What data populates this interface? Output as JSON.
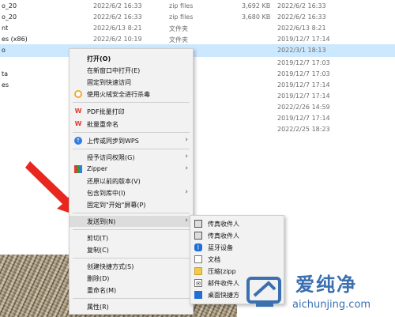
{
  "file_list": {
    "rows": [
      {
        "name": "o_20",
        "date": "2022/6/2 16:33",
        "type": "zip files",
        "size": "3,692 KB",
        "modified": "2022/6/2 16:33"
      },
      {
        "name": "o_20",
        "date": "2022/6/2 16:33",
        "type": "zip files",
        "size": "3,680 KB",
        "modified": "2022/6/2 16:33"
      },
      {
        "name": "nt",
        "date": "2022/6/13 8:21",
        "type": "文件夹",
        "size": "",
        "modified": "2022/6/13 8:21"
      },
      {
        "name": "es (x86)",
        "date": "2022/6/2 10:19",
        "type": "文件夹",
        "size": "",
        "modified": "2019/12/7 17:14"
      },
      {
        "name": "o",
        "date": "",
        "type": "",
        "size": "",
        "modified": "2022/3/1 18:13",
        "selected": true
      },
      {
        "name": "",
        "date": "",
        "type": "",
        "size": "",
        "modified": "2019/12/7 17:03"
      },
      {
        "name": "",
        "date": "",
        "type": "",
        "size": "",
        "modified": "2019/12/7 17:03"
      },
      {
        "name": "ta",
        "date": "",
        "type": "",
        "size": "",
        "modified": "2019/12/7 17:14"
      },
      {
        "name": "es",
        "date": "",
        "type": "",
        "size": "",
        "modified": "2019/12/7 17:14"
      },
      {
        "name": "",
        "date": "",
        "type": "",
        "size": "",
        "modified": "2022/2/26 14:59"
      },
      {
        "name": "",
        "date": "",
        "type": "",
        "size": "",
        "modified": "2019/12/7 17:14"
      },
      {
        "name": "",
        "date": "",
        "type": "",
        "size": "",
        "modified": "2022/2/25 18:23"
      }
    ]
  },
  "context_menu": {
    "items": [
      {
        "label": "打开(O)",
        "bold": true,
        "icon": "",
        "submenu": false
      },
      {
        "label": "在新窗口中打开(E)",
        "icon": "",
        "submenu": false
      },
      {
        "label": "固定到快速访问",
        "icon": "",
        "submenu": false
      },
      {
        "label": "使用火绒安全进行杀毒",
        "icon": "huorong-icon",
        "submenu": false
      },
      {
        "label": "PDF批量打印",
        "icon": "wps-pdf-icon",
        "submenu": false
      },
      {
        "label": "批量重命名",
        "icon": "wps-rename-icon",
        "submenu": false
      },
      {
        "label": "上传或同步到WPS",
        "icon": "wps-cloud-icon",
        "submenu": true
      },
      {
        "label": "授予访问权限(G)",
        "icon": "",
        "submenu": true
      },
      {
        "label": "Zipper",
        "icon": "zipper-icon",
        "submenu": true
      },
      {
        "label": "还原以前的版本(V)",
        "icon": "",
        "submenu": false
      },
      {
        "label": "包含到库中(I)",
        "icon": "",
        "submenu": true
      },
      {
        "label": "固定到\"开始\"屏幕(P)",
        "icon": "",
        "submenu": false
      },
      {
        "label": "发送到(N)",
        "icon": "",
        "submenu": true,
        "highlighted": true
      },
      {
        "label": "剪切(T)",
        "icon": "",
        "submenu": false
      },
      {
        "label": "复制(C)",
        "icon": "",
        "submenu": false
      },
      {
        "label": "创建快捷方式(S)",
        "icon": "",
        "submenu": false
      },
      {
        "label": "删除(D)",
        "icon": "",
        "submenu": false
      },
      {
        "label": "重命名(M)",
        "icon": "",
        "submenu": false
      },
      {
        "label": "属性(R)",
        "icon": "",
        "submenu": false
      }
    ]
  },
  "send_to_menu": {
    "items": [
      {
        "label": "传真收件人",
        "icon": "fax-icon"
      },
      {
        "label": "传真收件人",
        "icon": "fax-icon"
      },
      {
        "label": "蓝牙设备",
        "icon": "bluetooth-icon"
      },
      {
        "label": "文档",
        "icon": "documents-icon"
      },
      {
        "label": "压缩(zipp",
        "icon": "zip-folder-icon"
      },
      {
        "label": "邮件收件人",
        "icon": "mail-icon"
      },
      {
        "label": "桌面快捷方",
        "icon": "desktop-icon"
      }
    ]
  },
  "watermark": {
    "brand": "爱纯净",
    "url": "aichunjing.com"
  },
  "colors": {
    "selection": "#cce8ff",
    "menu_bg": "#f2f2f2",
    "arrow": "#e8271f",
    "watermark": "#3a6fb0"
  }
}
